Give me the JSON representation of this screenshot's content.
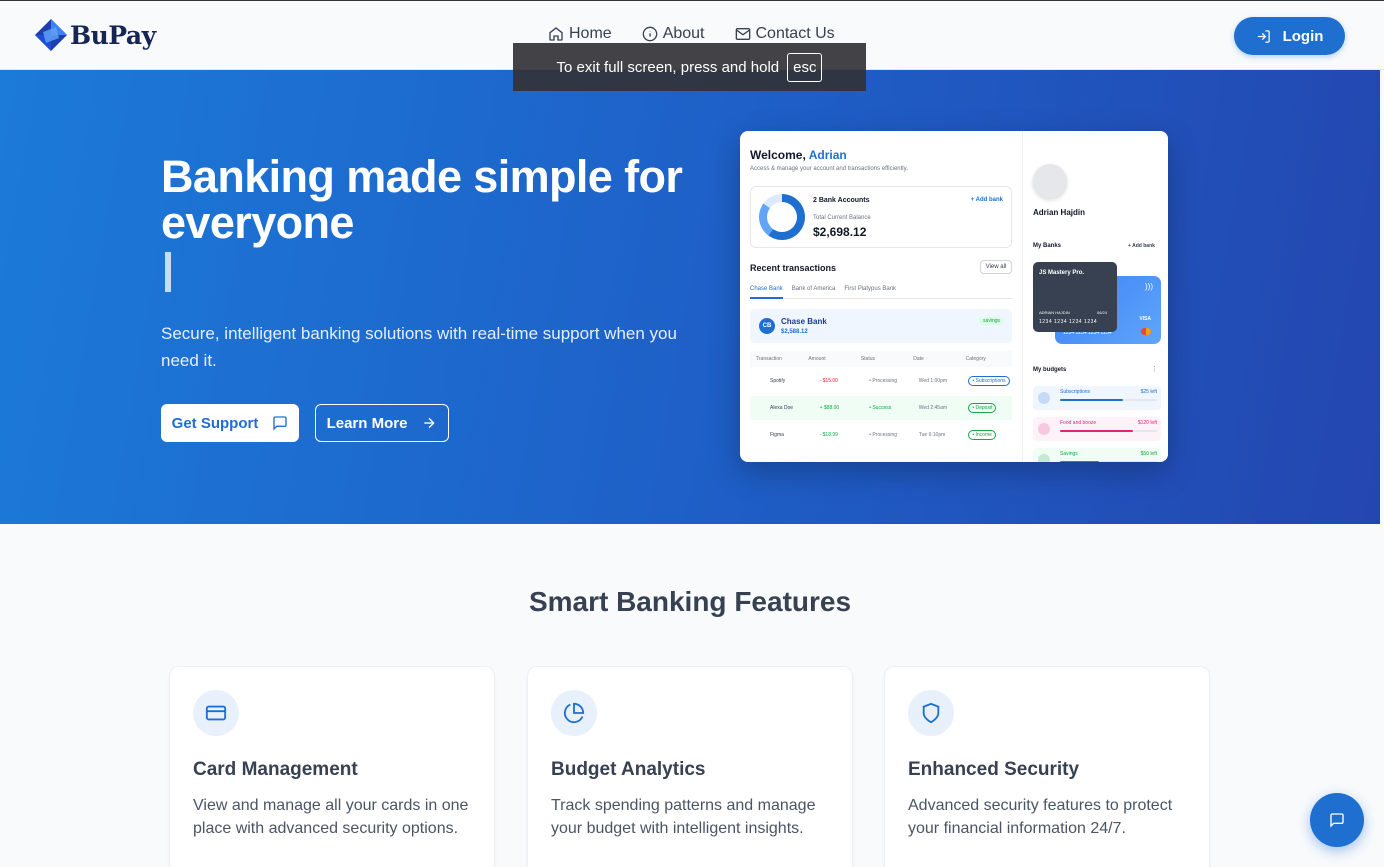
{
  "brand": {
    "name": "BuPay"
  },
  "nav": {
    "links": [
      {
        "label": "Home",
        "icon": "home-icon"
      },
      {
        "label": "About",
        "icon": "info-icon"
      },
      {
        "label": "Contact Us",
        "icon": "mail-icon"
      }
    ],
    "login_label": "Login"
  },
  "toast": {
    "text": "To exit full screen, press and hold",
    "key": "esc"
  },
  "hero": {
    "title": "Banking made simple for everyone",
    "subtitle": "Secure, intelligent banking solutions with real-time support when you need it.",
    "primary_cta": "Get Support",
    "secondary_cta": "Learn More"
  },
  "preview": {
    "welcome": "Welcome,",
    "user_first": "Adrian",
    "welcome_sub": "Access & manage your account and transactions efficiently.",
    "accounts": "2 Bank Accounts",
    "add_bank": "+ Add bank",
    "total_label": "Total Current Balance",
    "total_amount": "$2,698.12",
    "recent_title": "Recent transactions",
    "view_all": "View all",
    "tabs": [
      "Chase Bank",
      "Bank of America",
      "First Platypus Bank"
    ],
    "chase": {
      "initials": "CB",
      "name": "Chase Bank",
      "amount": "$2,588.12",
      "badge": "savings"
    },
    "table_headers": [
      "Transaction",
      "Amount",
      "Status",
      "Date",
      "Category"
    ],
    "rows": [
      {
        "name": "Spotify",
        "amount": "- $15.00",
        "status": "• Processing",
        "date": "Wed 1:00pm",
        "category": "• Subscriptions"
      },
      {
        "name": "Alexa Doe",
        "amount": "+ $88.00",
        "status": "• Success",
        "date": "Wed 2:45am",
        "category": "• Deposit"
      },
      {
        "name": "Figma",
        "amount": "- $18.99",
        "status": "• Processing",
        "date": "Tue 6:10pm",
        "category": "• Income"
      }
    ],
    "profile_name": "Adrian Hajdin",
    "my_banks": "My Banks",
    "add_bank2": "+ Add bank",
    "card": {
      "title": "JS Mastery Pro.",
      "holder": "ADRIAN HAJDIN",
      "expiry": "06/24",
      "number": "1234 1234 1234 1234",
      "back_number": "1234 1234 1234 1234",
      "network": "VISA"
    },
    "my_budgets": "My budgets",
    "budgets": [
      {
        "label": "Subscriptions",
        "left": "$25 left",
        "color": "#1e6fd0",
        "bg": "#eff6ff",
        "progress": 0.65
      },
      {
        "label": "Food and booze",
        "left": "$120 left",
        "color": "#db2777",
        "bg": "#fdf2f8",
        "progress": 0.75
      },
      {
        "label": "Savings",
        "left": "$50 left",
        "color": "#16a34a",
        "bg": "#f0fdf4",
        "progress": 0.4
      }
    ]
  },
  "features": {
    "title": "Smart Banking Features",
    "cards": [
      {
        "title": "Card Management",
        "description": "View and manage all your cards in one place with advanced security options.",
        "icon": "credit-card-icon"
      },
      {
        "title": "Budget Analytics",
        "description": "Track spending patterns and manage your budget with intelligent insights.",
        "icon": "pie-chart-icon"
      },
      {
        "title": "Enhanced Security",
        "description": "Advanced security features to protect your financial information 24/7.",
        "icon": "shield-icon"
      }
    ]
  },
  "colors": {
    "primary": "#1e6fd0",
    "hero_start": "#1c7ad8",
    "hero_end": "#2446b0"
  }
}
